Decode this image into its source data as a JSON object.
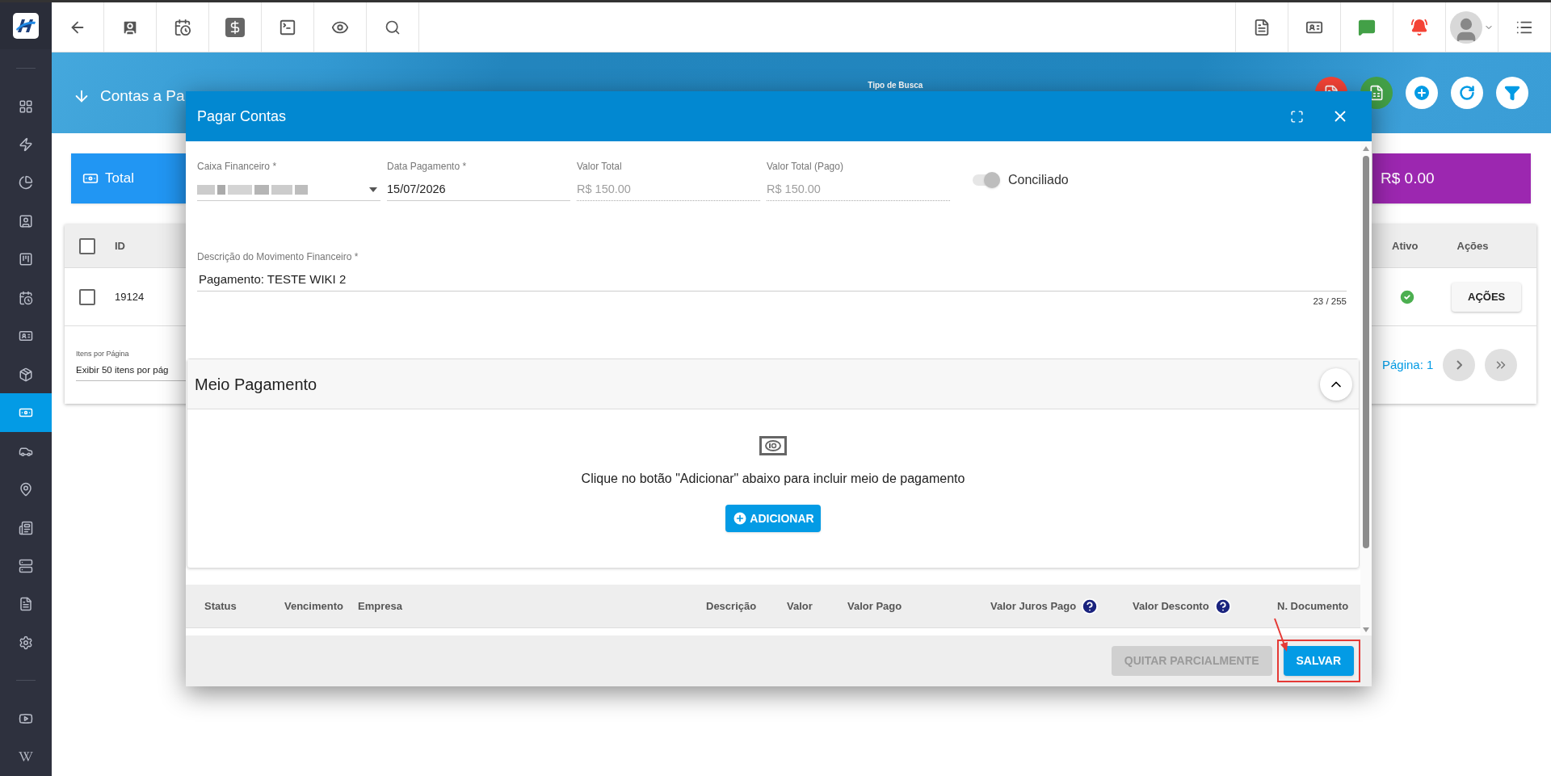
{
  "sidebar": {
    "items": [
      {
        "selected": false
      },
      {
        "selected": false
      },
      {
        "selected": false
      },
      {
        "selected": false
      },
      {
        "selected": false
      },
      {
        "selected": false
      },
      {
        "selected": false
      },
      {
        "selected": false
      },
      {
        "selected": true
      },
      {
        "selected": false
      },
      {
        "selected": false
      },
      {
        "selected": false
      },
      {
        "selected": false
      },
      {
        "selected": false
      },
      {
        "selected": false
      }
    ],
    "footer_items": [
      {
        "selected": false
      },
      {
        "selected": false
      }
    ]
  },
  "header": {
    "title": "Contas a Pa",
    "search_type_label": "Tipo de Busca"
  },
  "summary_cards": [
    {
      "kind": "label",
      "text": "Total",
      "color": "#2196f3"
    },
    {
      "kind": "amount",
      "text": "R$ 0.00",
      "color": "#9c27b0"
    }
  ],
  "table": {
    "header_checked": false,
    "columns": [
      "ID",
      "Ativo",
      "Ações"
    ],
    "rows": [
      {
        "checked": false,
        "id": "19124",
        "active": true,
        "action": "AÇÕES"
      }
    ]
  },
  "pagination": {
    "items_per_page_label": "Itens por Página",
    "items_per_page_value": "Exibir 50 itens por pág",
    "page": "Página: 1"
  },
  "dialog": {
    "title": "Pagar Contas",
    "fields": [
      {
        "kind": "select",
        "label": "Caixa Financeiro *"
      },
      {
        "kind": "text",
        "label": "Data Pagamento *",
        "value": "15/07/2026"
      },
      {
        "kind": "readonly",
        "label": "Valor Total",
        "value": "R$ 150.00"
      },
      {
        "kind": "readonly",
        "label": "Valor Total (Pago)",
        "value": "R$ 150.00"
      }
    ],
    "reconciled": {
      "label": "Conciliado",
      "on": true,
      "disabled": true
    },
    "description": {
      "label": "Descrição do Movimento Financeiro *",
      "value": "Pagamento: TESTE WIKI 2",
      "counter": "23 / 255"
    },
    "payment_section": {
      "title": "Meio Pagamento",
      "expanded": true,
      "message": "Clique no botão \"Adicionar\" abaixo para incluir meio de pagamento",
      "add_button": "ADICIONAR"
    },
    "columns": [
      {
        "label": "Status",
        "help": false
      },
      {
        "label": "Vencimento",
        "help": false
      },
      {
        "label": "Empresa",
        "help": false
      },
      {
        "label": "Descrição",
        "help": false
      },
      {
        "label": "Valor",
        "help": false
      },
      {
        "label": "Valor Pago",
        "help": false
      },
      {
        "label": "Valor Juros Pago",
        "help": true
      },
      {
        "label": "Valor Desconto",
        "help": true
      },
      {
        "label": "N. Documento",
        "help": false
      }
    ],
    "buttons": [
      {
        "label": "QUITAR PARCIALMENTE",
        "disabled": true,
        "highlighted": false
      },
      {
        "label": "SALVAR",
        "disabled": false,
        "highlighted": true
      }
    ]
  }
}
